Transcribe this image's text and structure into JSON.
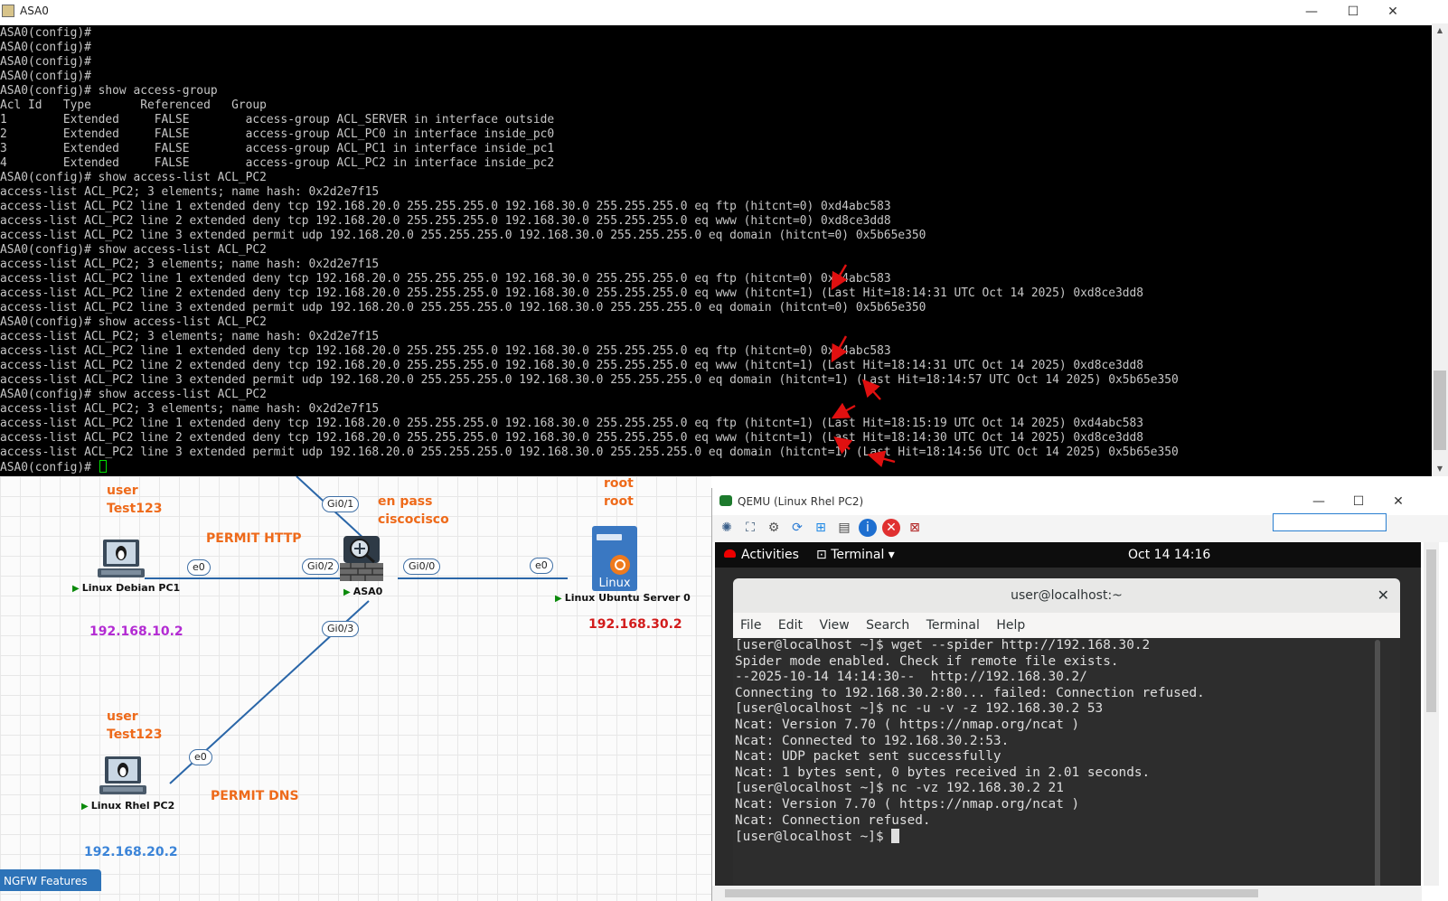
{
  "asa_window": {
    "title": "ASA0",
    "controls": {
      "minimize": "—",
      "maximize": "☐",
      "close": "✕"
    },
    "console_lines": [
      "ASA0(config)#",
      "ASA0(config)#",
      "ASA0(config)#",
      "ASA0(config)#",
      "ASA0(config)# show access-group",
      "Acl Id   Type       Referenced   Group",
      "1        Extended     FALSE        access-group ACL_SERVER in interface outside",
      "2        Extended     FALSE        access-group ACL_PC0 in interface inside_pc0",
      "3        Extended     FALSE        access-group ACL_PC1 in interface inside_pc1",
      "4        Extended     FALSE        access-group ACL_PC2 in interface inside_pc2",
      "ASA0(config)# show access-list ACL_PC2",
      "access-list ACL_PC2; 3 elements; name hash: 0x2d2e7f15",
      "access-list ACL_PC2 line 1 extended deny tcp 192.168.20.0 255.255.255.0 192.168.30.0 255.255.255.0 eq ftp (hitcnt=0) 0xd4abc583",
      "access-list ACL_PC2 line 2 extended deny tcp 192.168.20.0 255.255.255.0 192.168.30.0 255.255.255.0 eq www (hitcnt=0) 0xd8ce3dd8",
      "access-list ACL_PC2 line 3 extended permit udp 192.168.20.0 255.255.255.0 192.168.30.0 255.255.255.0 eq domain (hitcnt=0) 0x5b65e350",
      "ASA0(config)# show access-list ACL_PC2",
      "access-list ACL_PC2; 3 elements; name hash: 0x2d2e7f15",
      "access-list ACL_PC2 line 1 extended deny tcp 192.168.20.0 255.255.255.0 192.168.30.0 255.255.255.0 eq ftp (hitcnt=0) 0xd4abc583",
      "access-list ACL_PC2 line 2 extended deny tcp 192.168.20.0 255.255.255.0 192.168.30.0 255.255.255.0 eq www (hitcnt=1) (Last Hit=18:14:31 UTC Oct 14 2025) 0xd8ce3dd8",
      "access-list ACL_PC2 line 3 extended permit udp 192.168.20.0 255.255.255.0 192.168.30.0 255.255.255.0 eq domain (hitcnt=0) 0x5b65e350",
      "ASA0(config)# show access-list ACL_PC2",
      "access-list ACL_PC2; 3 elements; name hash: 0x2d2e7f15",
      "access-list ACL_PC2 line 1 extended deny tcp 192.168.20.0 255.255.255.0 192.168.30.0 255.255.255.0 eq ftp (hitcnt=0) 0xd4abc583",
      "access-list ACL_PC2 line 2 extended deny tcp 192.168.20.0 255.255.255.0 192.168.30.0 255.255.255.0 eq www (hitcnt=1) (Last Hit=18:14:31 UTC Oct 14 2025) 0xd8ce3dd8",
      "access-list ACL_PC2 line 3 extended permit udp 192.168.20.0 255.255.255.0 192.168.30.0 255.255.255.0 eq domain (hitcnt=1) (Last Hit=18:14:57 UTC Oct 14 2025) 0x5b65e350",
      "ASA0(config)# show access-list ACL_PC2",
      "access-list ACL_PC2; 3 elements; name hash: 0x2d2e7f15",
      "access-list ACL_PC2 line 1 extended deny tcp 192.168.20.0 255.255.255.0 192.168.30.0 255.255.255.0 eq ftp (hitcnt=1) (Last Hit=18:15:19 UTC Oct 14 2025) 0xd4abc583",
      "access-list ACL_PC2 line 2 extended deny tcp 192.168.20.0 255.255.255.0 192.168.30.0 255.255.255.0 eq www (hitcnt=1) (Last Hit=18:14:30 UTC Oct 14 2025) 0xd8ce3dd8",
      "access-list ACL_PC2 line 3 extended permit udp 192.168.20.0 255.255.255.0 192.168.30.0 255.255.255.0 eq domain (hitcnt=1) (Last Hit=18:14:56 UTC Oct 14 2025) 0x5b65e350",
      "ASA0(config)# "
    ],
    "annotation_color": "#e01010"
  },
  "topology": {
    "nodes": {
      "debian_pc1": "Linux Debian PC1",
      "asa": "ASA0",
      "ubuntu_server": "Linux Ubuntu Server 0",
      "rhel_pc2": "Linux Rhel PC2",
      "server_logo_text": "Linux"
    },
    "ports": {
      "debian_e0": "e0",
      "asa_gi0_2": "Gi0/2",
      "asa_gi0_1": "Gi0/1",
      "asa_gi0_0": "Gi0/0",
      "asa_gi0_3": "Gi0/3",
      "server_e0": "e0",
      "rhel_e0": "e0"
    },
    "notes": {
      "pc1_user": "user",
      "pc1_pass": "Test123",
      "permit_http": "PERMIT HTTP",
      "asa_enpass": "en pass",
      "asa_pass": "ciscocisco",
      "server_user": "root",
      "server_pass": "root",
      "pc1_ip": "192.168.10.2",
      "server_ip": "192.168.30.2",
      "pc2_user": "user",
      "pc2_pass": "Test123",
      "permit_dns": "PERMIT DNS",
      "pc2_ip": "192.168.20.2"
    },
    "bottom_tab": "NGFW Features",
    "colors": {
      "orange": "#ee6a1a",
      "purple": "#b32bd3",
      "red": "#d21b1b",
      "blue": "#3b84d8",
      "link": "#2a66a8"
    }
  },
  "qemu_window": {
    "title": "QEMU (Linux Rhel PC2)",
    "controls": {
      "minimize": "—",
      "maximize": "☐",
      "close": "✕"
    },
    "toolbar_icons": [
      "gear-cluster-icon",
      "fullscreen-icon",
      "settings-icon",
      "refresh-icon",
      "windows-icon",
      "console-icon",
      "info-icon",
      "stop-icon",
      "exit-icon"
    ],
    "gnome": {
      "activities": "Activities",
      "app_menu": "Terminal",
      "clock": "Oct 14  14:16"
    },
    "terminal": {
      "title": "user@localhost:~",
      "close": "✕",
      "menu": [
        "File",
        "Edit",
        "View",
        "Search",
        "Terminal",
        "Help"
      ],
      "lines": [
        "[user@localhost ~]$ wget --spider http://192.168.30.2",
        "Spider mode enabled. Check if remote file exists.",
        "--2025-10-14 14:14:30--  http://192.168.30.2/",
        "Connecting to 192.168.30.2:80... failed: Connection refused.",
        "[user@localhost ~]$ nc -u -v -z 192.168.30.2 53",
        "Ncat: Version 7.70 ( https://nmap.org/ncat )",
        "Ncat: Connected to 192.168.30.2:53.",
        "Ncat: UDP packet sent successfully",
        "Ncat: 1 bytes sent, 0 bytes received in 2.01 seconds.",
        "[user@localhost ~]$ nc -vz 192.168.30.2 21",
        "Ncat: Version 7.70 ( https://nmap.org/ncat )",
        "Ncat: Connection refused.",
        "[user@localhost ~]$ "
      ]
    }
  }
}
